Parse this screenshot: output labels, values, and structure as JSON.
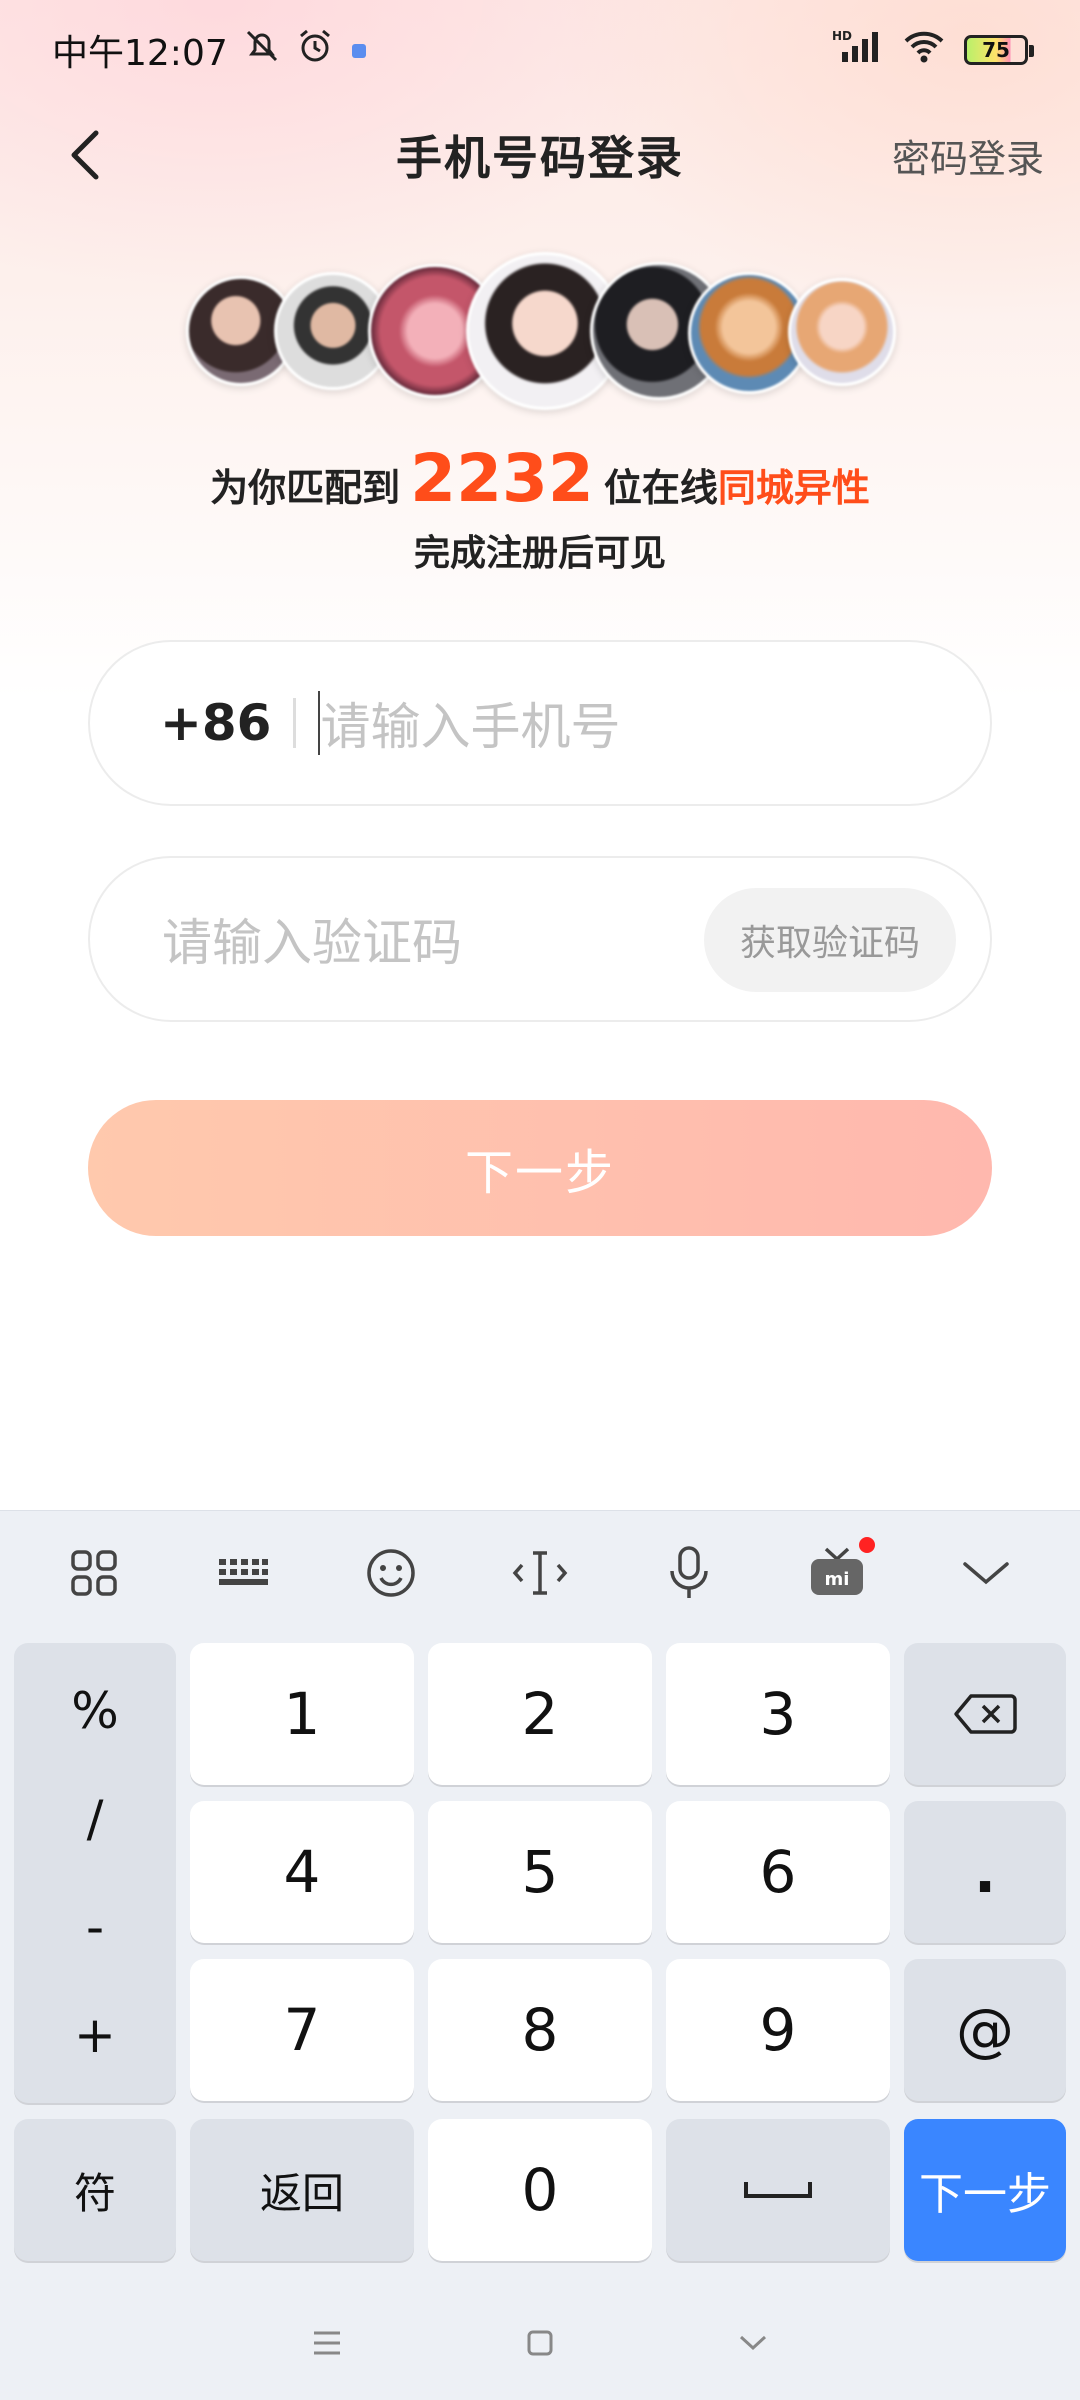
{
  "status_bar": {
    "time": "中午12:07",
    "battery": "75",
    "signal_label": "HD"
  },
  "header": {
    "title": "手机号码登录",
    "password_login": "密码登录"
  },
  "match": {
    "prefix": "为你匹配到",
    "count": "2232",
    "middle": "位在线",
    "highlight": "同城异性",
    "subtitle": "完成注册后可见"
  },
  "phone_field": {
    "country_code": "+86",
    "placeholder": "请输入手机号"
  },
  "code_field": {
    "placeholder": "请输入验证码",
    "get_code": "获取验证码"
  },
  "next_button": "下一步",
  "keyboard": {
    "toolbar": [
      "grid-icon",
      "keyboard-icon",
      "emoji-icon",
      "cursor-icon",
      "mic-icon",
      "tv-icon",
      "chevron-down-icon"
    ],
    "symbols": [
      "%",
      "/",
      "-",
      "+"
    ],
    "digits": [
      "1",
      "2",
      "3",
      "4",
      "5",
      "6",
      "7",
      "8",
      "9",
      "0"
    ],
    "dot": ".",
    "at": "@",
    "sym_key": "符",
    "back_key": "返回",
    "enter_key": "下一步"
  },
  "colors": {
    "accent": "#ff4d1a",
    "enter_key": "#3a86ff",
    "next_button_gradient": [
      "#ffc9ad",
      "#ffb8ae"
    ]
  }
}
